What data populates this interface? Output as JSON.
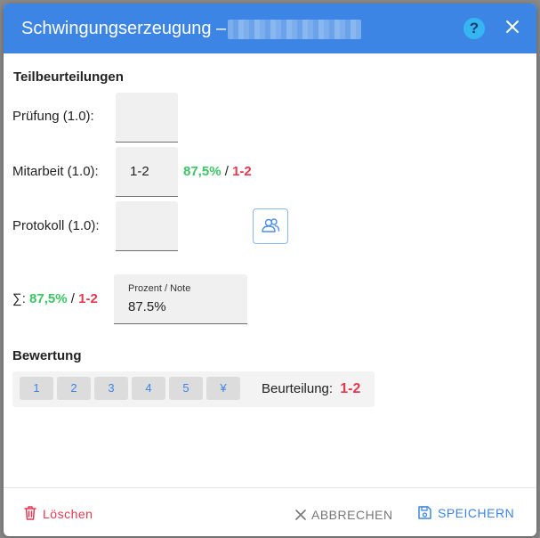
{
  "dialog": {
    "title": "Schwingungserzeugung –",
    "help_icon": "question-icon",
    "close_icon": "close-icon",
    "accent_color": "#3d85e4"
  },
  "partial": {
    "heading": "Teilbeurteilungen",
    "rows": [
      {
        "label": "Prüfung (1.0):",
        "value": ""
      },
      {
        "label": "Mitarbeit (1.0):",
        "value": "1-2",
        "percent": "87,5%",
        "grade": "1-2"
      },
      {
        "label": "Protokoll (1.0):",
        "value": ""
      }
    ],
    "people_icon": "people-icon"
  },
  "sum": {
    "symbol": "∑:",
    "percent": "87,5%",
    "grade": "1-2",
    "field_label": "Prozent / Note",
    "field_value": "87.5%"
  },
  "rating": {
    "heading": "Bewertung",
    "buttons": [
      "1",
      "2",
      "3",
      "4",
      "5",
      "¥"
    ],
    "result_label": "Beurteilung:",
    "result_value": "1-2"
  },
  "footer": {
    "delete_label": "Löschen",
    "cancel_label": "ABBRECHEN",
    "save_label": "SPEICHERN",
    "delete_color": "#e53950",
    "save_color": "#3d85e4"
  },
  "separator": "/"
}
